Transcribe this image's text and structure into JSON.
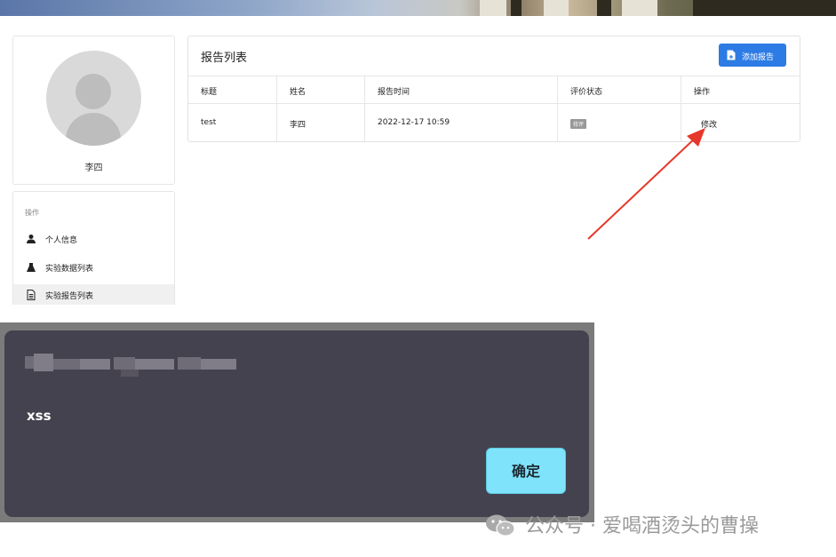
{
  "profile": {
    "name": "李四"
  },
  "menu": {
    "header": "操作",
    "items": [
      {
        "label": "个人信息",
        "icon": "user-icon"
      },
      {
        "label": "实验数据列表",
        "icon": "flask-icon"
      },
      {
        "label": "实验报告列表",
        "icon": "document-icon"
      }
    ]
  },
  "reports": {
    "title": "报告列表",
    "add_button": "添加报告",
    "columns": [
      "标题",
      "姓名",
      "报告时间",
      "评价状态",
      "操作"
    ],
    "rows": [
      {
        "title": "test",
        "name": "李四",
        "time": "2022-12-17 10:59",
        "status": "待评",
        "action": "修改"
      }
    ]
  },
  "dialog": {
    "message": "xss",
    "ok_label": "确定"
  },
  "watermark": {
    "text": "公众号 · 爱喝酒烫头的曹操"
  },
  "colors": {
    "accent": "#2d7be5",
    "annotation": "#e6372a",
    "dialog_bg": "#45424f",
    "ok_button": "#7fe3fb"
  }
}
